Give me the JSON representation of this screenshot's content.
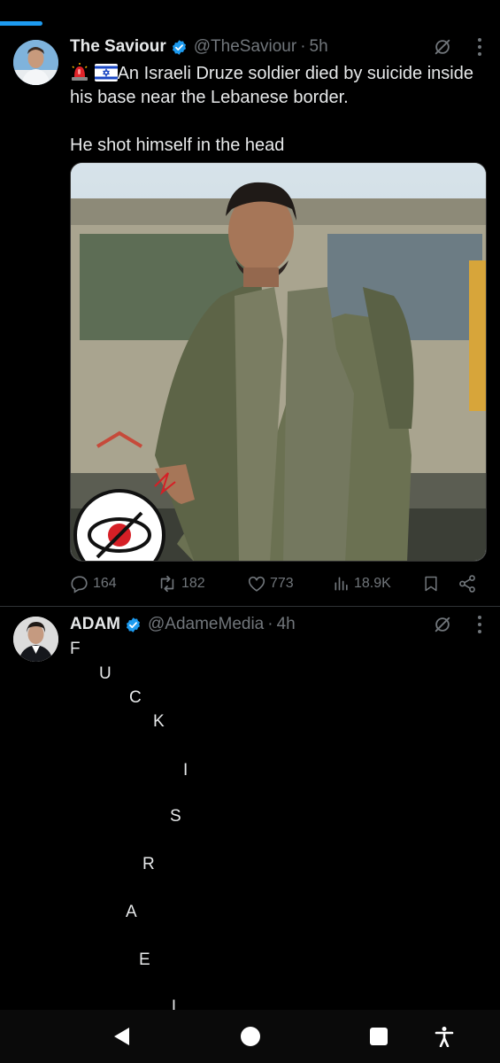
{
  "tweets": [
    {
      "name": "The Saviour",
      "handle": "@TheSaviour",
      "separator": "·",
      "time": "5h",
      "text_line1": "An Israeli Druze soldier died by suicide inside his base near the Lebanese border.",
      "text_line2": "He shot himself in the head",
      "stats": {
        "replies": "164",
        "reposts": "182",
        "likes": "773",
        "views": "18.9K"
      }
    },
    {
      "name": "ADAM",
      "handle": "@AdameMedia",
      "separator": "·",
      "time": "4h",
      "letters": [
        "F",
        "U",
        "C",
        "K",
        "I",
        "S",
        "R",
        "A",
        "E",
        "L"
      ]
    }
  ],
  "colors": {
    "background": "#000000",
    "text": "#e7e9ea",
    "muted": "#71767b",
    "verified": "#1d9bf0",
    "divider": "#2f3336"
  },
  "icons": [
    "siren-icon",
    "israel-flag-icon",
    "verified-icon",
    "grok-icon",
    "more-icon",
    "reply-icon",
    "repost-icon",
    "like-icon",
    "views-icon",
    "bookmark-icon",
    "share-icon",
    "back-icon",
    "home-icon",
    "recents-icon",
    "accessibility-icon"
  ]
}
